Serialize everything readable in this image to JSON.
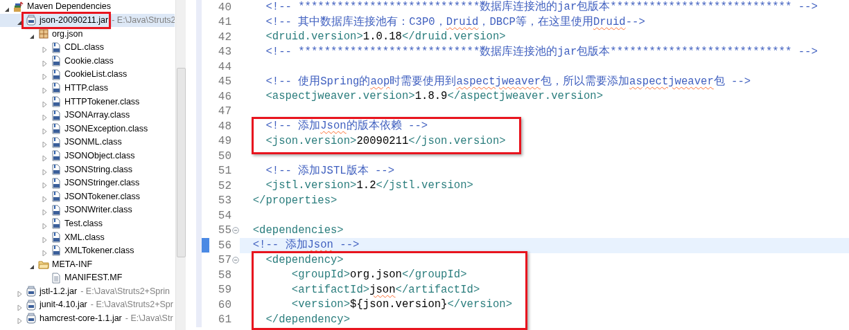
{
  "tree": [
    {
      "label": "Maven Dependencies",
      "kind": "maven",
      "expanded": true,
      "selected": false,
      "children": [
        {
          "label": "json-20090211.jar",
          "detail": "- E:\\Java\\Struts2",
          "kind": "jar",
          "expanded": true,
          "selected": true,
          "boxed": true,
          "children": [
            {
              "label": "org.json",
              "kind": "package",
              "expanded": true,
              "selected": false,
              "children": [
                {
                  "label": "CDL.class",
                  "kind": "class",
                  "expanded": false,
                  "selected": false
                },
                {
                  "label": "Cookie.class",
                  "kind": "class",
                  "expanded": false,
                  "selected": false
                },
                {
                  "label": "CookieList.class",
                  "kind": "class",
                  "expanded": false,
                  "selected": false
                },
                {
                  "label": "HTTP.class",
                  "kind": "class",
                  "expanded": false,
                  "selected": false
                },
                {
                  "label": "HTTPTokener.class",
                  "kind": "class",
                  "expanded": false,
                  "selected": false
                },
                {
                  "label": "JSONArray.class",
                  "kind": "class",
                  "expanded": false,
                  "selected": false
                },
                {
                  "label": "JSONException.class",
                  "kind": "class",
                  "expanded": false,
                  "selected": false
                },
                {
                  "label": "JSONML.class",
                  "kind": "class",
                  "expanded": false,
                  "selected": false
                },
                {
                  "label": "JSONObject.class",
                  "kind": "class",
                  "expanded": false,
                  "selected": false
                },
                {
                  "label": "JSONString.class",
                  "kind": "class",
                  "expanded": false,
                  "selected": false
                },
                {
                  "label": "JSONStringer.class",
                  "kind": "class",
                  "expanded": false,
                  "selected": false
                },
                {
                  "label": "JSONTokener.class",
                  "kind": "class",
                  "expanded": false,
                  "selected": false
                },
                {
                  "label": "JSONWriter.class",
                  "kind": "class",
                  "expanded": false,
                  "selected": false
                },
                {
                  "label": "Test.class",
                  "kind": "class",
                  "expanded": false,
                  "selected": false
                },
                {
                  "label": "XML.class",
                  "kind": "class",
                  "expanded": false,
                  "selected": false
                },
                {
                  "label": "XMLTokener.class",
                  "kind": "class",
                  "expanded": false,
                  "selected": false
                }
              ]
            },
            {
              "label": "META-INF",
              "kind": "folder",
              "expanded": true,
              "selected": false,
              "children": [
                {
                  "label": "MANIFEST.MF",
                  "kind": "file",
                  "selected": false
                }
              ]
            }
          ]
        },
        {
          "label": "jstl-1.2.jar",
          "detail": "- E:\\Java\\Struts2+Sprin",
          "kind": "jar",
          "expanded": false,
          "selected": false
        },
        {
          "label": "junit-4.10.jar",
          "detail": "- E:\\Java\\Struts2+Spr",
          "kind": "jar",
          "expanded": false,
          "selected": false
        },
        {
          "label": "hamcrest-core-1.1.jar",
          "detail": "- E:\\Java\\Str",
          "kind": "jar",
          "expanded": false,
          "selected": false
        }
      ]
    }
  ],
  "editor": {
    "lines": [
      {
        "number": "40",
        "current": false,
        "segments": [
          {
            "t": "    <!-- ****************************数据库连接池的jar包版本**************************** -->",
            "kind": "comment"
          }
        ]
      },
      {
        "number": "41",
        "current": false,
        "segments": [
          {
            "t": "    <!-- 其中数据库连接池有：C3P0，",
            "kind": "comment"
          },
          {
            "t": "Druid",
            "kind": "typo"
          },
          {
            "t": "，DBCP等，在这里使用",
            "kind": "comment"
          },
          {
            "t": "Druid",
            "kind": "typo"
          },
          {
            "t": "-->",
            "kind": "comment"
          }
        ]
      },
      {
        "number": "42",
        "current": false,
        "segments": [
          {
            "t": "    <druid.version>",
            "kind": "tag"
          },
          {
            "t": "1.0.18",
            "kind": "value"
          },
          {
            "t": "</druid.version>",
            "kind": "tag"
          }
        ]
      },
      {
        "number": "43",
        "current": false,
        "segments": [
          {
            "t": "    <!-- ****************************数据库连接池的jar包版本**************************** -->",
            "kind": "comment"
          }
        ]
      },
      {
        "number": "44",
        "current": false
      },
      {
        "number": "45",
        "current": false,
        "segments": [
          {
            "t": "    <!-- 使用Spring的",
            "kind": "comment"
          },
          {
            "t": "aop",
            "kind": "typo"
          },
          {
            "t": "时需要使用到",
            "kind": "comment"
          },
          {
            "t": "aspectjweaver",
            "kind": "typo"
          },
          {
            "t": "包，所以需要添加",
            "kind": "comment"
          },
          {
            "t": "aspectjweaver",
            "kind": "typo"
          },
          {
            "t": "包 -->",
            "kind": "comment"
          }
        ]
      },
      {
        "number": "46",
        "current": false,
        "segments": [
          {
            "t": "    <aspectjweaver.version>",
            "kind": "tag"
          },
          {
            "t": "1.8.9",
            "kind": "value"
          },
          {
            "t": "</aspectjweaver.version>",
            "kind": "tag"
          }
        ]
      },
      {
        "number": "47",
        "current": false
      },
      {
        "number": "48",
        "current": false,
        "boxed": true,
        "segments": [
          {
            "t": "    <!-- 添加",
            "kind": "comment"
          },
          {
            "t": "Json",
            "kind": "typo"
          },
          {
            "t": "的版本依赖 -->",
            "kind": "comment"
          }
        ]
      },
      {
        "number": "49",
        "current": false,
        "boxed": true,
        "segments": [
          {
            "t": "    <json.version>",
            "kind": "tag"
          },
          {
            "t": "20090211",
            "kind": "value"
          },
          {
            "t": "</json.version>",
            "kind": "tag"
          }
        ]
      },
      {
        "number": "50",
        "current": false
      },
      {
        "number": "51",
        "current": false,
        "segments": [
          {
            "t": "    <!-- 添加JSTL版本 -->",
            "kind": "comment"
          }
        ]
      },
      {
        "number": "52",
        "current": false,
        "segments": [
          {
            "t": "    <jstl.version>",
            "kind": "tag"
          },
          {
            "t": "1.2",
            "kind": "value"
          },
          {
            "t": "</jstl.version>",
            "kind": "tag"
          }
        ]
      },
      {
        "number": "53",
        "current": false,
        "segments": [
          {
            "t": "  </properties>",
            "kind": "tag"
          }
        ]
      },
      {
        "number": "54",
        "current": false
      },
      {
        "number": "55",
        "current": false,
        "foldable": true,
        "segments": [
          {
            "t": "  <dependencies>",
            "kind": "tag"
          }
        ]
      },
      {
        "number": "56",
        "current": true,
        "segments": [
          {
            "t": "  <!-- 添加",
            "kind": "comment"
          },
          {
            "t": "Json",
            "kind": "typo"
          },
          {
            "t": " -->",
            "kind": "comment"
          }
        ]
      },
      {
        "number": "57",
        "current": false,
        "boxed": true,
        "foldable": true,
        "segments": [
          {
            "t": "    <dependency>",
            "kind": "tag"
          }
        ]
      },
      {
        "number": "58",
        "current": false,
        "boxed": true,
        "segments": [
          {
            "t": "        <groupId>",
            "kind": "tag"
          },
          {
            "t": "org.json",
            "kind": "value"
          },
          {
            "t": "</groupId>",
            "kind": "tag"
          }
        ]
      },
      {
        "number": "59",
        "current": false,
        "boxed": true,
        "segments": [
          {
            "t": "        <artifactId>",
            "kind": "tag"
          },
          {
            "t": "json",
            "kind": "typovalue"
          },
          {
            "t": "</artifactId>",
            "kind": "tag"
          }
        ]
      },
      {
        "number": "60",
        "current": false,
        "boxed": true,
        "segments": [
          {
            "t": "        <version>",
            "kind": "tag"
          },
          {
            "t": "${json.version}",
            "kind": "value"
          },
          {
            "t": "</version>",
            "kind": "tag"
          }
        ]
      },
      {
        "number": "61",
        "current": false,
        "boxed": true,
        "segments": [
          {
            "t": "    </dependency>",
            "kind": "tag"
          }
        ]
      }
    ]
  }
}
